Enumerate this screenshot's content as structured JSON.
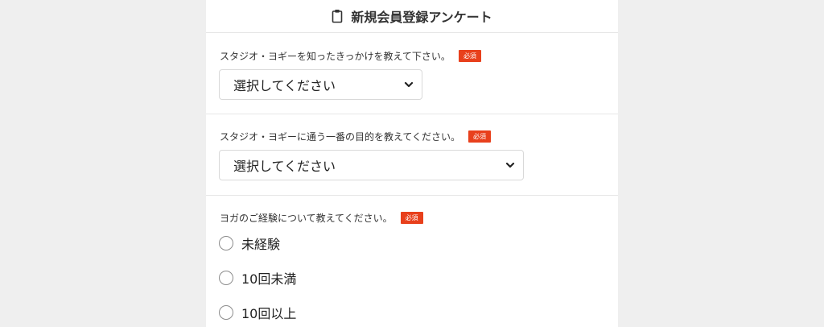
{
  "header": {
    "title": "新規会員登録アンケート"
  },
  "required_badge": "必須",
  "questions": [
    {
      "label": "スタジオ・ヨギーを知ったきっかけを教えて下さい。",
      "select_value": "選択してください"
    },
    {
      "label": "スタジオ・ヨギーに通う一番の目的を教えてください。",
      "select_value": "選択してください"
    },
    {
      "label": "ヨガのご経験について教えてください。",
      "options": [
        "未経験",
        "10回未満",
        "10回以上"
      ]
    }
  ],
  "colors": {
    "badge": "#e8401c",
    "background": "#efefef",
    "panel": "#ffffff"
  }
}
